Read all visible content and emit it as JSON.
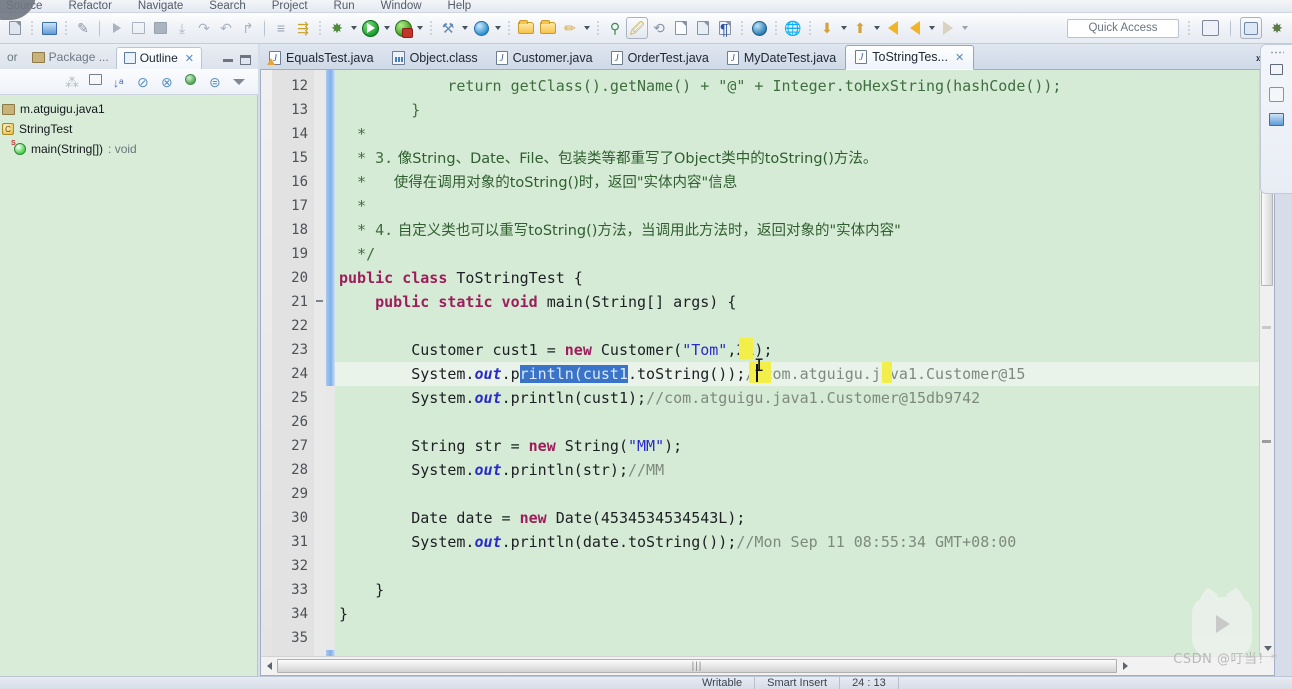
{
  "menu": {
    "items": [
      "Source",
      "Refactor",
      "Navigate",
      "Search",
      "Project",
      "Run",
      "Window",
      "Help"
    ]
  },
  "toolbar": {
    "quick_access_placeholder": "Quick Access",
    "icons": [
      "save-icon",
      "new-java-project-icon",
      "open-type-icon",
      "resume-icon",
      "suspend-icon",
      "terminate-icon",
      "step-into-icon",
      "step-over-icon",
      "step-return-icon",
      "drop-to-frame-icon",
      "use-step-filters-icon",
      "skip-breakpoints-icon",
      "debug-icon",
      "run-icon",
      "coverage-icon",
      "external-tools-icon",
      "search-icon",
      "open-folder-icon",
      "new-folder-icon",
      "pencil-icon",
      "new-java-file-icon",
      "toggle-mark-occurrences-icon",
      "link-icon",
      "open-task-icon",
      "open-book-icon",
      "paragraph-icon",
      "globe-icon",
      "web-browser-icon",
      "previous-annotation-icon",
      "next-annotation-icon",
      "back-icon",
      "forward-icon",
      "next-edit-icon"
    ]
  },
  "perspective": {
    "open_perspective_label": "open-perspective-icon",
    "java_perspective_label": "java-perspective-icon",
    "debug_perspective_label": "debug-perspective-icon"
  },
  "left_panel": {
    "tabs": [
      {
        "label": "or",
        "icon": "editor-icon",
        "active": false
      },
      {
        "label": "Package ...",
        "icon": "package-explorer-icon",
        "active": false
      },
      {
        "label": "Outline",
        "icon": "outline-icon",
        "active": true
      }
    ],
    "view_buttons": [
      "minimize-view-button",
      "maximize-view-button"
    ],
    "toolbar_icons": [
      "focus-on-active-task-icon",
      "collapse-all-icon",
      "sort-icon",
      "hide-fields-icon",
      "hide-static-icon",
      "hide-non-public-icon",
      "hide-local-types-icon",
      "view-menu-icon"
    ],
    "outline": [
      {
        "icon": "package-icon",
        "label": "m.atguigu.java1",
        "detail": "",
        "indent": 0
      },
      {
        "icon": "class-icon",
        "label": "StringTest",
        "detail": "",
        "indent": 0
      },
      {
        "icon": "method-icon",
        "label": "main(String[])",
        "detail": " : void",
        "indent": 1
      }
    ]
  },
  "editor": {
    "tabs": [
      {
        "label": "EqualsTest.java",
        "icon": "java-file-warning-icon",
        "active": false,
        "closable": false
      },
      {
        "label": "Object.class",
        "icon": "class-file-icon",
        "active": false,
        "closable": false
      },
      {
        "label": "Customer.java",
        "icon": "java-file-icon",
        "active": false,
        "closable": false
      },
      {
        "label": "OrderTest.java",
        "icon": "java-file-icon",
        "active": false,
        "closable": false
      },
      {
        "label": "MyDateTest.java",
        "icon": "java-file-icon",
        "active": false,
        "closable": false
      },
      {
        "label": "ToStringTes...",
        "icon": "java-file-icon",
        "active": true,
        "closable": true
      }
    ],
    "tab_close_glyph": "✕",
    "overflow_chevron": "»",
    "overflow_count": "1",
    "first_line_number": 12,
    "lines": [
      {
        "n": 12,
        "segments": [
          {
            "t": "            return getClass().getName() + ",
            "c": "cmtb"
          },
          {
            "t": "\"@\"",
            "c": "cmtb"
          },
          {
            "t": " + Integer.toHexString(hashCode());",
            "c": "cmtb"
          }
        ]
      },
      {
        "n": 13,
        "segments": [
          {
            "t": "        }",
            "c": "cmtb"
          }
        ]
      },
      {
        "n": 14,
        "segments": [
          {
            "t": "  *",
            "c": "cmtb"
          }
        ]
      },
      {
        "n": 15,
        "segments": [
          {
            "t": "  * 3.",
            "c": "cmtb"
          },
          {
            "t": " 像String、Date、File、包装类等都重写了Object类中的toString()方法。",
            "c": "cn"
          }
        ]
      },
      {
        "n": 16,
        "segments": [
          {
            "t": "  *",
            "c": "cmtb"
          },
          {
            "t": "      使得在调用对象的toString()时，返回\"实体内容\"信息",
            "c": "cn"
          }
        ]
      },
      {
        "n": 17,
        "segments": [
          {
            "t": "  *",
            "c": "cmtb"
          }
        ]
      },
      {
        "n": 18,
        "segments": [
          {
            "t": "  * 4.",
            "c": "cmtb"
          },
          {
            "t": " 自定义类也可以重写toString()方法，当调用此方法时，返回对象的\"实体内容\"",
            "c": "cn"
          }
        ]
      },
      {
        "n": 19,
        "segments": [
          {
            "t": "  */",
            "c": "cmtb"
          }
        ]
      },
      {
        "n": 20,
        "segments": [
          {
            "t": "public class ",
            "c": "kw"
          },
          {
            "t": "ToStringTest {",
            "c": "typ"
          }
        ]
      },
      {
        "n": 21,
        "segments": [
          {
            "t": "    ",
            "c": "typ"
          },
          {
            "t": "public static void ",
            "c": "kw"
          },
          {
            "t": "main(String[] args) {",
            "c": "typ"
          }
        ]
      },
      {
        "n": 22,
        "segments": []
      },
      {
        "n": 23,
        "segments": [
          {
            "t": "        Customer cust1 = ",
            "c": "typ"
          },
          {
            "t": "new ",
            "c": "kw"
          },
          {
            "t": "Customer(",
            "c": "typ"
          },
          {
            "t": "\"Tom\"",
            "c": "str"
          },
          {
            "t": ",21);",
            "c": "typ"
          }
        ]
      },
      {
        "n": 24,
        "segments": [
          {
            "t": "        System.",
            "c": "typ"
          },
          {
            "t": "out",
            "c": "fld"
          },
          {
            "t": ".p",
            "c": "typ"
          },
          {
            "t": "rintln(cust1",
            "c": "sel"
          },
          {
            "t": ".toString());",
            "c": "typ"
          },
          {
            "t": "//com.atguigu.java1.Customer@15",
            "c": "cmt"
          }
        ]
      },
      {
        "n": 25,
        "segments": [
          {
            "t": "        System.",
            "c": "typ"
          },
          {
            "t": "out",
            "c": "fld"
          },
          {
            "t": ".println(cust1);",
            "c": "typ"
          },
          {
            "t": "//com.atguigu.java1.Customer@15db9742",
            "c": "cmt"
          }
        ]
      },
      {
        "n": 26,
        "segments": []
      },
      {
        "n": 27,
        "segments": [
          {
            "t": "        String str = ",
            "c": "typ"
          },
          {
            "t": "new ",
            "c": "kw"
          },
          {
            "t": "String(",
            "c": "typ"
          },
          {
            "t": "\"MM\"",
            "c": "str"
          },
          {
            "t": ");",
            "c": "typ"
          }
        ]
      },
      {
        "n": 28,
        "segments": [
          {
            "t": "        System.",
            "c": "typ"
          },
          {
            "t": "out",
            "c": "fld"
          },
          {
            "t": ".println(str);",
            "c": "typ"
          },
          {
            "t": "//MM",
            "c": "cmt"
          }
        ]
      },
      {
        "n": 29,
        "segments": []
      },
      {
        "n": 30,
        "segments": [
          {
            "t": "        Date date = ",
            "c": "typ"
          },
          {
            "t": "new ",
            "c": "kw"
          },
          {
            "t": "Date(4534534534543L);",
            "c": "typ"
          }
        ]
      },
      {
        "n": 31,
        "segments": [
          {
            "t": "        System.",
            "c": "typ"
          },
          {
            "t": "out",
            "c": "fld"
          },
          {
            "t": ".println(date.toString());",
            "c": "typ"
          },
          {
            "t": "//Mon Sep 11 08:55:34 GMT+08:00",
            "c": "cmt"
          }
        ]
      },
      {
        "n": 32,
        "segments": []
      },
      {
        "n": 33,
        "segments": [
          {
            "t": "    }",
            "c": "typ"
          }
        ]
      },
      {
        "n": 34,
        "segments": [
          {
            "t": "}",
            "c": "typ"
          }
        ]
      },
      {
        "n": 35,
        "segments": []
      }
    ],
    "selection_text": "rintln(cust1",
    "caret_line": 24,
    "highlight_color": "#f2ef4a",
    "selection_color": "#3a74c8",
    "background_color": "#d5ebd5"
  },
  "right_bar": {
    "icons": [
      "restore-icon",
      "debug-perspective-icon",
      "java-perspective-icon"
    ]
  },
  "statusbar": {
    "cells": [
      "Writable",
      "Smart Insert",
      "24 : 13"
    ]
  },
  "watermark": {
    "text": "CSDN @叮当！*"
  }
}
